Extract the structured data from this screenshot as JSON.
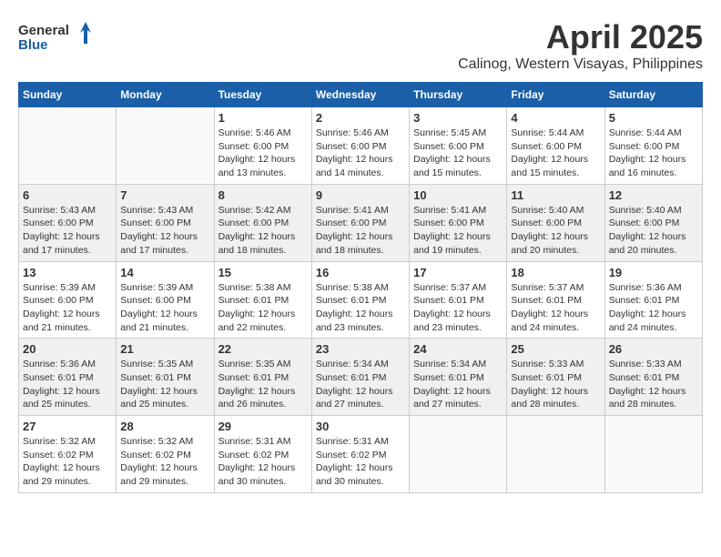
{
  "header": {
    "logo_general": "General",
    "logo_blue": "Blue",
    "month_title": "April 2025",
    "subtitle": "Calinog, Western Visayas, Philippines"
  },
  "days_of_week": [
    "Sunday",
    "Monday",
    "Tuesday",
    "Wednesday",
    "Thursday",
    "Friday",
    "Saturday"
  ],
  "weeks": [
    [
      {
        "day": "",
        "info": ""
      },
      {
        "day": "",
        "info": ""
      },
      {
        "day": "1",
        "info": "Sunrise: 5:46 AM\nSunset: 6:00 PM\nDaylight: 12 hours and 13 minutes."
      },
      {
        "day": "2",
        "info": "Sunrise: 5:46 AM\nSunset: 6:00 PM\nDaylight: 12 hours and 14 minutes."
      },
      {
        "day": "3",
        "info": "Sunrise: 5:45 AM\nSunset: 6:00 PM\nDaylight: 12 hours and 15 minutes."
      },
      {
        "day": "4",
        "info": "Sunrise: 5:44 AM\nSunset: 6:00 PM\nDaylight: 12 hours and 15 minutes."
      },
      {
        "day": "5",
        "info": "Sunrise: 5:44 AM\nSunset: 6:00 PM\nDaylight: 12 hours and 16 minutes."
      }
    ],
    [
      {
        "day": "6",
        "info": "Sunrise: 5:43 AM\nSunset: 6:00 PM\nDaylight: 12 hours and 17 minutes."
      },
      {
        "day": "7",
        "info": "Sunrise: 5:43 AM\nSunset: 6:00 PM\nDaylight: 12 hours and 17 minutes."
      },
      {
        "day": "8",
        "info": "Sunrise: 5:42 AM\nSunset: 6:00 PM\nDaylight: 12 hours and 18 minutes."
      },
      {
        "day": "9",
        "info": "Sunrise: 5:41 AM\nSunset: 6:00 PM\nDaylight: 12 hours and 18 minutes."
      },
      {
        "day": "10",
        "info": "Sunrise: 5:41 AM\nSunset: 6:00 PM\nDaylight: 12 hours and 19 minutes."
      },
      {
        "day": "11",
        "info": "Sunrise: 5:40 AM\nSunset: 6:00 PM\nDaylight: 12 hours and 20 minutes."
      },
      {
        "day": "12",
        "info": "Sunrise: 5:40 AM\nSunset: 6:00 PM\nDaylight: 12 hours and 20 minutes."
      }
    ],
    [
      {
        "day": "13",
        "info": "Sunrise: 5:39 AM\nSunset: 6:00 PM\nDaylight: 12 hours and 21 minutes."
      },
      {
        "day": "14",
        "info": "Sunrise: 5:39 AM\nSunset: 6:00 PM\nDaylight: 12 hours and 21 minutes."
      },
      {
        "day": "15",
        "info": "Sunrise: 5:38 AM\nSunset: 6:01 PM\nDaylight: 12 hours and 22 minutes."
      },
      {
        "day": "16",
        "info": "Sunrise: 5:38 AM\nSunset: 6:01 PM\nDaylight: 12 hours and 23 minutes."
      },
      {
        "day": "17",
        "info": "Sunrise: 5:37 AM\nSunset: 6:01 PM\nDaylight: 12 hours and 23 minutes."
      },
      {
        "day": "18",
        "info": "Sunrise: 5:37 AM\nSunset: 6:01 PM\nDaylight: 12 hours and 24 minutes."
      },
      {
        "day": "19",
        "info": "Sunrise: 5:36 AM\nSunset: 6:01 PM\nDaylight: 12 hours and 24 minutes."
      }
    ],
    [
      {
        "day": "20",
        "info": "Sunrise: 5:36 AM\nSunset: 6:01 PM\nDaylight: 12 hours and 25 minutes."
      },
      {
        "day": "21",
        "info": "Sunrise: 5:35 AM\nSunset: 6:01 PM\nDaylight: 12 hours and 25 minutes."
      },
      {
        "day": "22",
        "info": "Sunrise: 5:35 AM\nSunset: 6:01 PM\nDaylight: 12 hours and 26 minutes."
      },
      {
        "day": "23",
        "info": "Sunrise: 5:34 AM\nSunset: 6:01 PM\nDaylight: 12 hours and 27 minutes."
      },
      {
        "day": "24",
        "info": "Sunrise: 5:34 AM\nSunset: 6:01 PM\nDaylight: 12 hours and 27 minutes."
      },
      {
        "day": "25",
        "info": "Sunrise: 5:33 AM\nSunset: 6:01 PM\nDaylight: 12 hours and 28 minutes."
      },
      {
        "day": "26",
        "info": "Sunrise: 5:33 AM\nSunset: 6:01 PM\nDaylight: 12 hours and 28 minutes."
      }
    ],
    [
      {
        "day": "27",
        "info": "Sunrise: 5:32 AM\nSunset: 6:02 PM\nDaylight: 12 hours and 29 minutes."
      },
      {
        "day": "28",
        "info": "Sunrise: 5:32 AM\nSunset: 6:02 PM\nDaylight: 12 hours and 29 minutes."
      },
      {
        "day": "29",
        "info": "Sunrise: 5:31 AM\nSunset: 6:02 PM\nDaylight: 12 hours and 30 minutes."
      },
      {
        "day": "30",
        "info": "Sunrise: 5:31 AM\nSunset: 6:02 PM\nDaylight: 12 hours and 30 minutes."
      },
      {
        "day": "",
        "info": ""
      },
      {
        "day": "",
        "info": ""
      },
      {
        "day": "",
        "info": ""
      }
    ]
  ]
}
